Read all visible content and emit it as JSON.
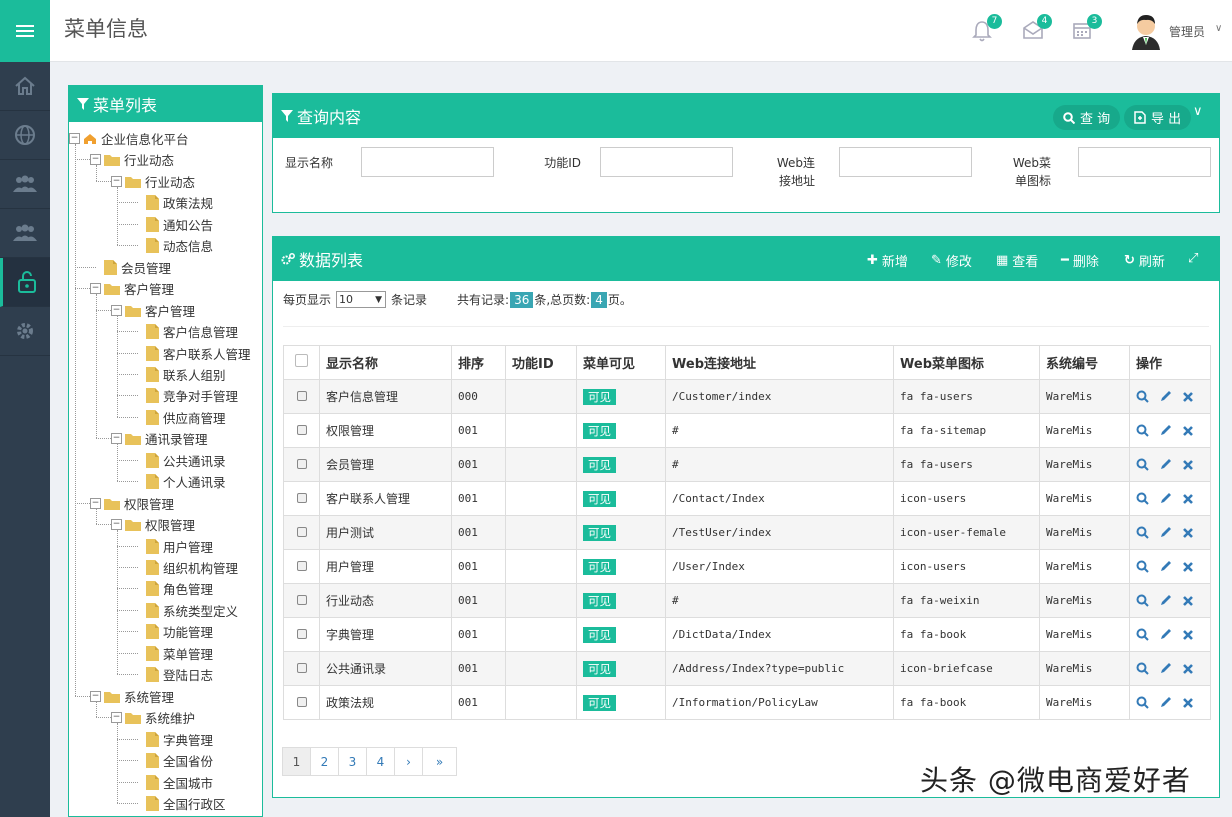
{
  "header": {
    "title": "菜单信息",
    "notifications": [
      {
        "icon": "bell-icon",
        "count": "7"
      },
      {
        "icon": "mail-icon",
        "count": "4"
      },
      {
        "icon": "calendar-icon",
        "count": "3"
      }
    ],
    "user_name": "管理员"
  },
  "tree_panel": {
    "title": "菜单列表",
    "nodes": [
      {
        "label": "企业信息化平台",
        "depth": 0,
        "type": "root",
        "toggle": "−"
      },
      {
        "label": "行业动态",
        "depth": 1,
        "type": "folder",
        "toggle": "−"
      },
      {
        "label": "行业动态",
        "depth": 2,
        "type": "folder",
        "toggle": "−"
      },
      {
        "label": "政策法规",
        "depth": 3,
        "type": "doc"
      },
      {
        "label": "通知公告",
        "depth": 3,
        "type": "doc"
      },
      {
        "label": "动态信息",
        "depth": 3,
        "type": "doc"
      },
      {
        "label": "会员管理",
        "depth": 1,
        "type": "doc"
      },
      {
        "label": "客户管理",
        "depth": 1,
        "type": "folder",
        "toggle": "−"
      },
      {
        "label": "客户管理",
        "depth": 2,
        "type": "folder",
        "toggle": "−"
      },
      {
        "label": "客户信息管理",
        "depth": 3,
        "type": "doc"
      },
      {
        "label": "客户联系人管理",
        "depth": 3,
        "type": "doc"
      },
      {
        "label": "联系人组别",
        "depth": 3,
        "type": "doc"
      },
      {
        "label": "竞争对手管理",
        "depth": 3,
        "type": "doc"
      },
      {
        "label": "供应商管理",
        "depth": 3,
        "type": "doc"
      },
      {
        "label": "通讯录管理",
        "depth": 2,
        "type": "folder",
        "toggle": "−"
      },
      {
        "label": "公共通讯录",
        "depth": 3,
        "type": "doc"
      },
      {
        "label": "个人通讯录",
        "depth": 3,
        "type": "doc"
      },
      {
        "label": "权限管理",
        "depth": 1,
        "type": "folder",
        "toggle": "−"
      },
      {
        "label": "权限管理",
        "depth": 2,
        "type": "folder",
        "toggle": "−"
      },
      {
        "label": "用户管理",
        "depth": 3,
        "type": "doc"
      },
      {
        "label": "组织机构管理",
        "depth": 3,
        "type": "doc"
      },
      {
        "label": "角色管理",
        "depth": 3,
        "type": "doc"
      },
      {
        "label": "系统类型定义",
        "depth": 3,
        "type": "doc"
      },
      {
        "label": "功能管理",
        "depth": 3,
        "type": "doc"
      },
      {
        "label": "菜单管理",
        "depth": 3,
        "type": "doc"
      },
      {
        "label": "登陆日志",
        "depth": 3,
        "type": "doc"
      },
      {
        "label": "系统管理",
        "depth": 1,
        "type": "folder",
        "toggle": "−"
      },
      {
        "label": "系统维护",
        "depth": 2,
        "type": "folder",
        "toggle": "−"
      },
      {
        "label": "字典管理",
        "depth": 3,
        "type": "doc"
      },
      {
        "label": "全国省份",
        "depth": 3,
        "type": "doc"
      },
      {
        "label": "全国城市",
        "depth": 3,
        "type": "doc"
      },
      {
        "label": "全国行政区",
        "depth": 3,
        "type": "doc"
      }
    ]
  },
  "query": {
    "title": "查询内容",
    "search_label": "查 询",
    "export_label": "导 出",
    "fields": [
      {
        "label": "显示名称",
        "value": ""
      },
      {
        "label": "功能ID",
        "value": ""
      },
      {
        "label": "Web连接地址",
        "value": ""
      },
      {
        "label": "Web菜单图标",
        "value": ""
      }
    ]
  },
  "data_list": {
    "title": "数据列表",
    "toolbar": {
      "add": "新增",
      "edit": "修改",
      "view": "查看",
      "delete": "删除",
      "refresh": "刷新"
    },
    "page_size_prefix": "每页显示",
    "page_size": "10",
    "page_size_suffix": "条记录",
    "total_prefix": "共有记录:",
    "total_records": "36",
    "total_mid": "条,总页数:",
    "total_pages": "4",
    "total_suffix": "页。",
    "columns": [
      "显示名称",
      "排序",
      "功能ID",
      "菜单可见",
      "Web连接地址",
      "Web菜单图标",
      "系统编号",
      "操作"
    ],
    "rows": [
      {
        "name": "客户信息管理",
        "sort": "000",
        "func_id": "",
        "visible": "可见",
        "url": "/Customer/index",
        "icon": "fa fa-users",
        "system": "WareMis"
      },
      {
        "name": "权限管理",
        "sort": "001",
        "func_id": "",
        "visible": "可见",
        "url": "#",
        "icon": "fa fa-sitemap",
        "system": "WareMis"
      },
      {
        "name": "会员管理",
        "sort": "001",
        "func_id": "",
        "visible": "可见",
        "url": "#",
        "icon": "fa fa-users",
        "system": "WareMis"
      },
      {
        "name": "客户联系人管理",
        "sort": "001",
        "func_id": "",
        "visible": "可见",
        "url": "/Contact/Index",
        "icon": "icon-users",
        "system": "WareMis"
      },
      {
        "name": "用户测试",
        "sort": "001",
        "func_id": "",
        "visible": "可见",
        "url": "/TestUser/index",
        "icon": "icon-user-female",
        "system": "WareMis"
      },
      {
        "name": "用户管理",
        "sort": "001",
        "func_id": "",
        "visible": "可见",
        "url": "/User/Index",
        "icon": "icon-users",
        "system": "WareMis"
      },
      {
        "name": "行业动态",
        "sort": "001",
        "func_id": "",
        "visible": "可见",
        "url": "#",
        "icon": "fa fa-weixin",
        "system": "WareMis"
      },
      {
        "name": "字典管理",
        "sort": "001",
        "func_id": "",
        "visible": "可见",
        "url": "/DictData/Index",
        "icon": "fa fa-book",
        "system": "WareMis"
      },
      {
        "name": "公共通讯录",
        "sort": "001",
        "func_id": "",
        "visible": "可见",
        "url": "/Address/Index?type=public",
        "icon": "icon-briefcase",
        "system": "WareMis"
      },
      {
        "name": "政策法规",
        "sort": "001",
        "func_id": "",
        "visible": "可见",
        "url": "/Information/PolicyLaw",
        "icon": "fa fa-book",
        "system": "WareMis"
      }
    ],
    "pager": [
      "1",
      "2",
      "3",
      "4",
      "›",
      "»"
    ]
  },
  "watermark": "头条 @微电商爱好者",
  "colors": {
    "accent": "#1bbc9b",
    "sidebar": "#2f3e4e",
    "badge": "#3aa6b3"
  }
}
